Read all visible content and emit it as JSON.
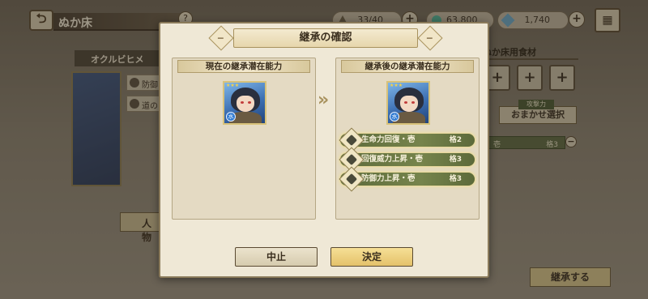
{
  "header": {
    "back_icon": "back-arrow-icon",
    "title": "ぬか床",
    "help_icon": "question-icon"
  },
  "resources": [
    {
      "icon": "stamina-icon",
      "value": "33/40",
      "color": "#7a6e58"
    },
    {
      "icon": "gem-icon",
      "value": "63,800",
      "color": "#4fb39a"
    },
    {
      "icon": "crystal-icon",
      "value": "1,740",
      "color": "#6aa8c8"
    }
  ],
  "menu_icon": "menu-icon",
  "character": {
    "name": "オクルビヒメ",
    "skills_visible": [
      "防御",
      "道の"
    ],
    "people_button": "人物"
  },
  "food": {
    "title": "ぬか床用食材",
    "slot_symbol": "+",
    "attack_label": "攻撃力",
    "auto_select": "おまかせ選択",
    "slot_bar_text": "壱",
    "slot_bar_rank": "格3",
    "remove_symbol": "−"
  },
  "inherit_button": "継承する",
  "modal": {
    "title": "継承の確認",
    "left_ornament": "−",
    "right_ornament": "−",
    "current_panel_title": "現在の継承潜在能力",
    "after_panel_title": "継承後の継承潜在能力",
    "arrow": "»",
    "element_icon": "水",
    "stars": "★★★",
    "after_skills": [
      {
        "name": "生命力回復・壱",
        "rank": "格2"
      },
      {
        "name": "回復威力上昇・壱",
        "rank": "格3"
      },
      {
        "name": "防御力上昇・壱",
        "rank": "格3"
      }
    ],
    "cancel": "中止",
    "confirm": "決定"
  }
}
